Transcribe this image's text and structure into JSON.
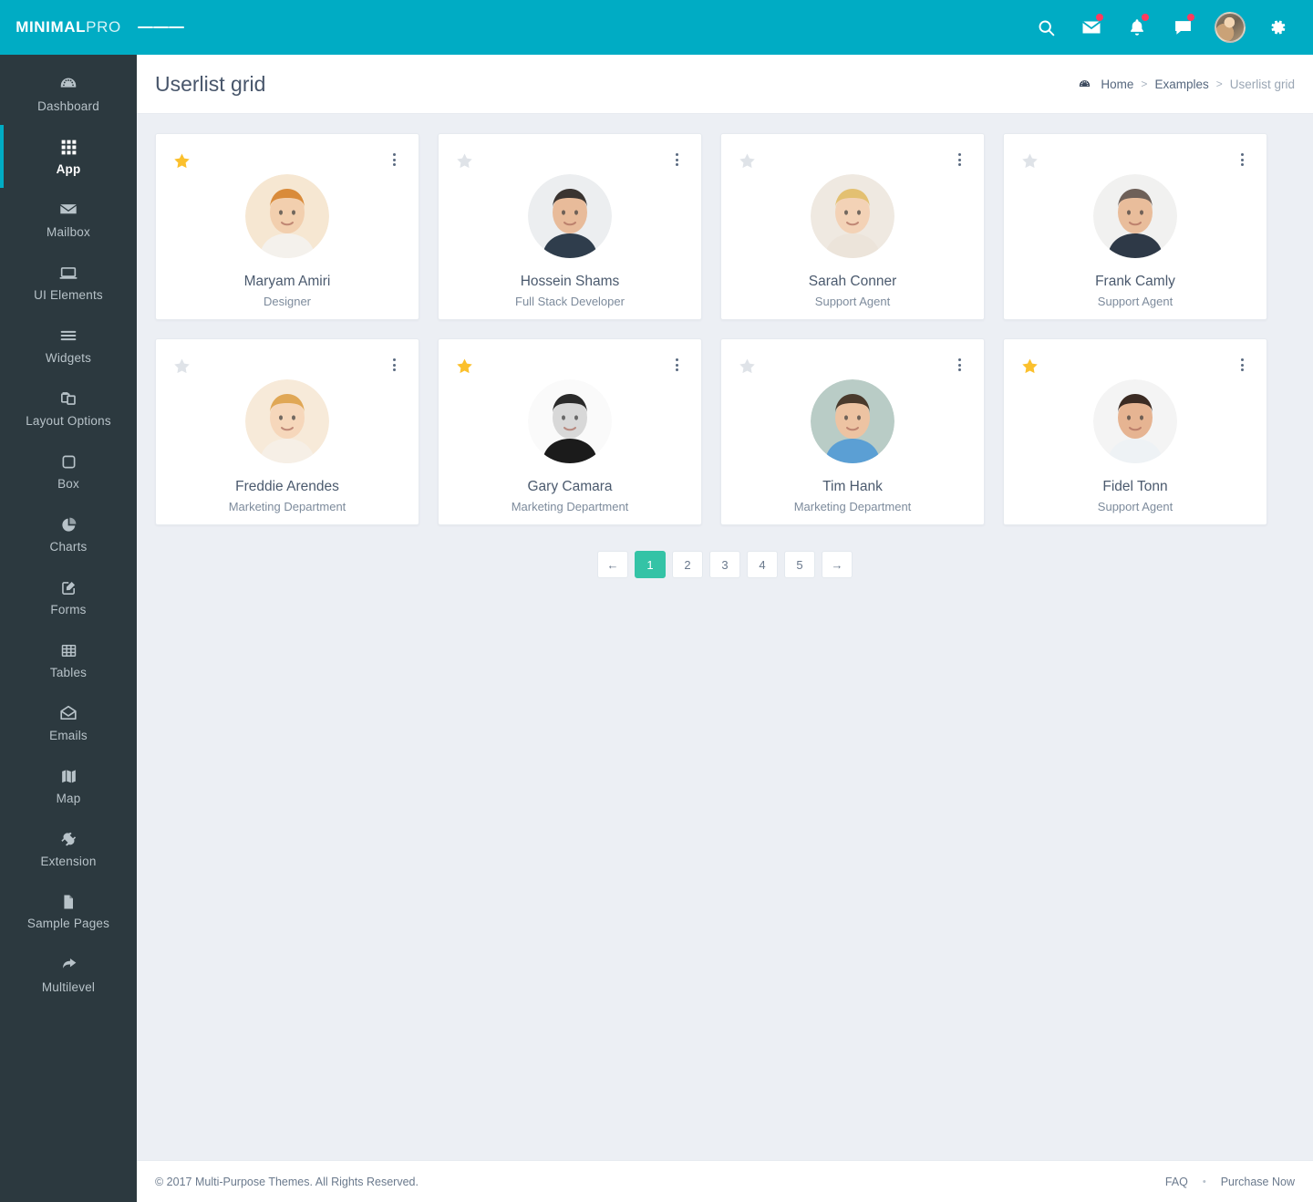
{
  "brand": {
    "bold": "MINIMAL",
    "light": "PRO"
  },
  "topbar": {
    "menu_toggle": "menu-toggle",
    "icons": [
      {
        "name": "search-icon",
        "badge": false
      },
      {
        "name": "mail-icon",
        "badge": true
      },
      {
        "name": "bell-icon",
        "badge": true
      },
      {
        "name": "chat-icon",
        "badge": true
      }
    ],
    "avatar_label": "user-avatar",
    "settings_label": "settings-gear"
  },
  "sidebar": {
    "items": [
      {
        "label": "Dashboard",
        "icon": "dashboard-icon",
        "active": false
      },
      {
        "label": "App",
        "icon": "apps-grid-icon",
        "active": true
      },
      {
        "label": "Mailbox",
        "icon": "envelope-icon",
        "active": false
      },
      {
        "label": "UI Elements",
        "icon": "monitor-icon",
        "active": false
      },
      {
        "label": "Widgets",
        "icon": "lines-icon",
        "active": false
      },
      {
        "label": "Layout Options",
        "icon": "layers-icon",
        "active": false
      },
      {
        "label": "Box",
        "icon": "square-icon",
        "active": false
      },
      {
        "label": "Charts",
        "icon": "pie-chart-icon",
        "active": false
      },
      {
        "label": "Forms",
        "icon": "edit-pencil-icon",
        "active": false
      },
      {
        "label": "Tables",
        "icon": "table-grid-icon",
        "active": false
      },
      {
        "label": "Emails",
        "icon": "open-envelope-icon",
        "active": false
      },
      {
        "label": "Map",
        "icon": "map-icon",
        "active": false
      },
      {
        "label": "Extension",
        "icon": "plug-icon",
        "active": false
      },
      {
        "label": "Sample Pages",
        "icon": "document-icon",
        "active": false
      },
      {
        "label": "Multilevel",
        "icon": "arrow-curve-icon",
        "active": false
      }
    ]
  },
  "page": {
    "title": "Userlist grid",
    "breadcrumb": [
      {
        "label": "Home",
        "current": false
      },
      {
        "label": "Examples",
        "current": false
      },
      {
        "label": "Userlist grid",
        "current": true
      }
    ],
    "breadcrumb_separator": ">"
  },
  "users": [
    {
      "name": "Maryam Amiri",
      "role": "Designer",
      "starred": true,
      "avatar": {
        "bg": "#f6e7d2",
        "skin": "#f2cfae",
        "hair": "#d98b3a",
        "cloth": "#f4f1ec"
      }
    },
    {
      "name": "Hossein Shams",
      "role": "Full Stack Developer",
      "starred": false,
      "avatar": {
        "bg": "#eceef0",
        "skin": "#e8bb9a",
        "hair": "#3a3431",
        "cloth": "#2f3d4c"
      }
    },
    {
      "name": "Sarah Conner",
      "role": "Support Agent",
      "starred": false,
      "avatar": {
        "bg": "#efe9e1",
        "skin": "#f3d2b6",
        "hair": "#e3c071",
        "cloth": "#ece4da"
      }
    },
    {
      "name": "Frank Camly",
      "role": "Support Agent",
      "starred": false,
      "avatar": {
        "bg": "#f1f1f0",
        "skin": "#e9bd9b",
        "hair": "#6e6058",
        "cloth": "#2e3947"
      }
    },
    {
      "name": "Freddie Arendes",
      "role": "Marketing Department",
      "starred": false,
      "avatar": {
        "bg": "#f7ead9",
        "skin": "#f6d7bb",
        "hair": "#e0a755",
        "cloth": "#f6efe6"
      }
    },
    {
      "name": "Gary Camara",
      "role": "Marketing Department",
      "starred": true,
      "avatar": {
        "bg": "#fafafa",
        "skin": "#d8d8d8",
        "hair": "#2a2a2a",
        "cloth": "#1b1b1b"
      }
    },
    {
      "name": "Tim Hank",
      "role": "Marketing Department",
      "starred": false,
      "avatar": {
        "bg": "#b9ccc6",
        "skin": "#edc3a2",
        "hair": "#4a3a2c",
        "cloth": "#5b9fd4"
      }
    },
    {
      "name": "Fidel Tonn",
      "role": "Support Agent",
      "starred": true,
      "avatar": {
        "bg": "#f4f4f4",
        "skin": "#e6b492",
        "hair": "#3b2b23",
        "cloth": "#eef2f5"
      }
    }
  ],
  "pagination": {
    "prev": "←",
    "next": "→",
    "pages": [
      "1",
      "2",
      "3",
      "4",
      "5"
    ],
    "active": "1"
  },
  "footer": {
    "copyright": "© 2017 Multi-Purpose Themes. All Rights Reserved.",
    "faq": "FAQ",
    "separator": "•",
    "purchase": "Purchase Now"
  },
  "colors": {
    "header": "#00acc4",
    "sidebar": "#2c393f",
    "accent": "#00acc4",
    "pager_active": "#34c3a6",
    "star_on": "#fbc02d",
    "star_off": "#dfe3e8",
    "badge": "#ff3a5e",
    "page_bg": "#eceff4"
  }
}
